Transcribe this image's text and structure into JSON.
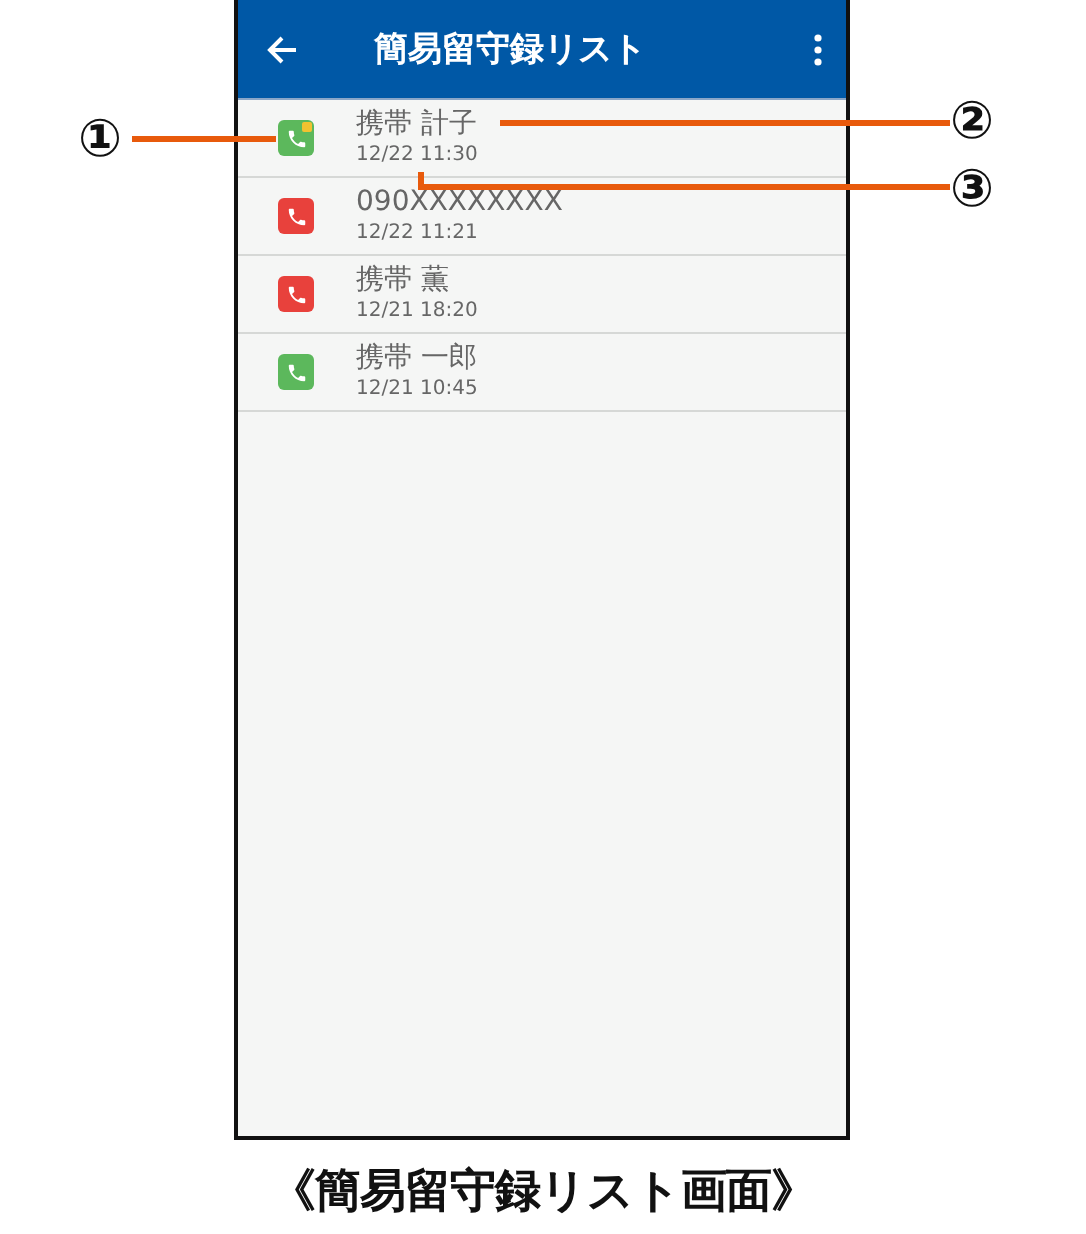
{
  "app_bar": {
    "title": "簡易留守録リスト"
  },
  "records": [
    {
      "name": "携帯 計子",
      "time": "12/22 11:30",
      "color": "#5cb85c",
      "protected": true
    },
    {
      "name": "090XXXXXXXX",
      "time": "12/22 11:21",
      "color": "#e8413c",
      "protected": false
    },
    {
      "name": "携帯 薫",
      "time": "12/21 18:20",
      "color": "#e8413c",
      "protected": false
    },
    {
      "name": "携帯 一郎",
      "time": "12/21 10:45",
      "color": "#5cb85c",
      "protected": false
    }
  ],
  "callouts": [
    {
      "label": "①"
    },
    {
      "label": "②"
    },
    {
      "label": "③"
    }
  ],
  "caption": "《簡易留守録リスト画面》"
}
